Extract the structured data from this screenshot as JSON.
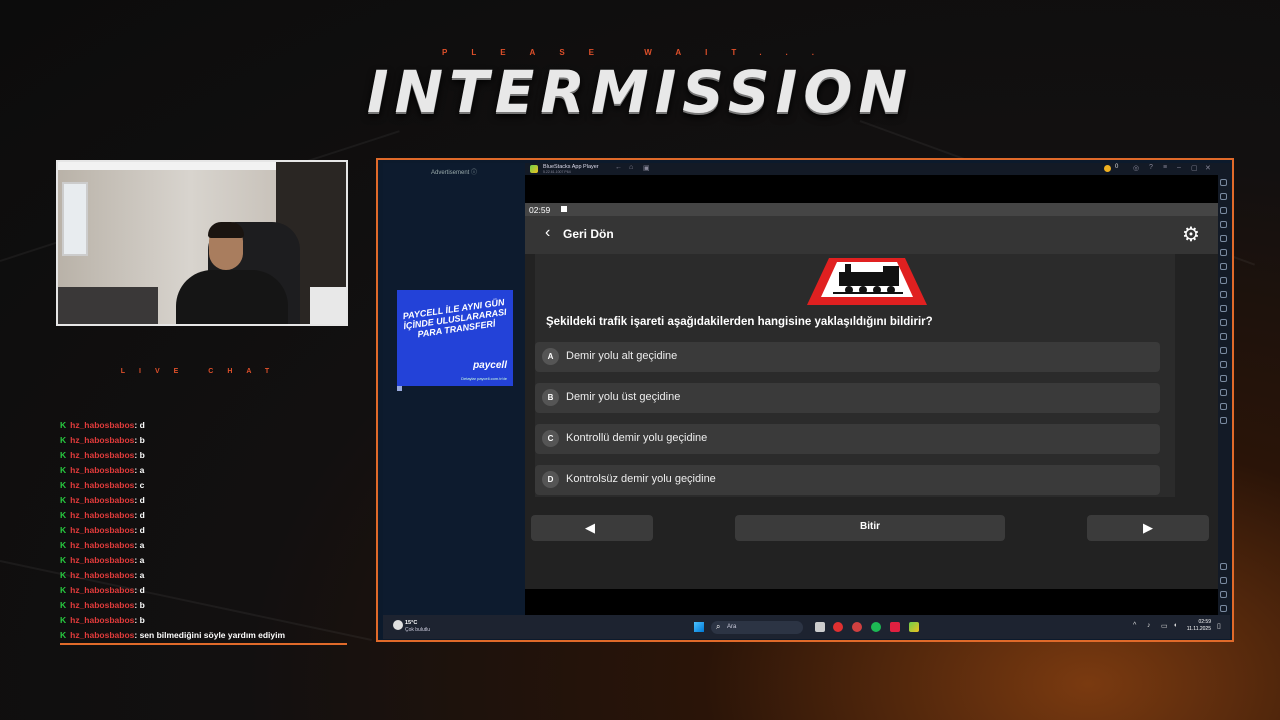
{
  "header": {
    "subtitle": "PLEASE WAIT...",
    "title": "INTERMISSION"
  },
  "live_chat": {
    "label": "LIVE CHAT",
    "messages": [
      {
        "badge": "K",
        "user": "hz_habosbabos",
        "text": ": d"
      },
      {
        "badge": "K",
        "user": "hz_habosbabos",
        "text": ": b"
      },
      {
        "badge": "K",
        "user": "hz_habosbabos",
        "text": ": b"
      },
      {
        "badge": "K",
        "user": "hz_habosbabos",
        "text": ": a"
      },
      {
        "badge": "K",
        "user": "hz_habosbabos",
        "text": ": c"
      },
      {
        "badge": "K",
        "user": "hz_habosbabos",
        "text": ": d"
      },
      {
        "badge": "K",
        "user": "hz_habosbabos",
        "text": ": d"
      },
      {
        "badge": "K",
        "user": "hz_habosbabos",
        "text": ": d"
      },
      {
        "badge": "K",
        "user": "hz_habosbabos",
        "text": ": a"
      },
      {
        "badge": "K",
        "user": "hz_habosbabos",
        "text": ": a"
      },
      {
        "badge": "K",
        "user": "hz_habosbabos",
        "text": ": a"
      },
      {
        "badge": "K",
        "user": "hz_habosbabos",
        "text": ": d"
      },
      {
        "badge": "K",
        "user": "hz_habosbabos",
        "text": ": b"
      },
      {
        "badge": "K",
        "user": "hz_habosbabos",
        "text": ": b"
      },
      {
        "badge": "K",
        "user": "hz_habosbabos",
        "text": ": sen bilmediğini söyle yardım ediyim"
      }
    ]
  },
  "ad": {
    "label": "Advertisement ⓘ",
    "headline": "PAYCELL İLE AYNI GÜN İÇİNDE ULUSLARARASI PARA TRANSFERİ",
    "brand": "paycell",
    "subtext": "Detaylar paycell.com.tr'de"
  },
  "bluestacks": {
    "title": "BlueStacks App Player",
    "subtitle": "5.22.61.1007 P64",
    "coins": "0",
    "status_time": "02:59",
    "back_label": "Geri Dön",
    "question": "Şekildeki trafik işareti aşağıdakilerden hangisine yaklaşıldığını bildirir?",
    "options": [
      {
        "letter": "A",
        "text": "Demir yolu alt geçidine"
      },
      {
        "letter": "B",
        "text": "Demir yolu üst geçidine"
      },
      {
        "letter": "C",
        "text": "Kontrollü demir yolu geçidine"
      },
      {
        "letter": "D",
        "text": "Kontrolsüz demir yolu geçidine"
      }
    ],
    "finish_label": "Bitir",
    "prev_icon": "◀",
    "next_icon": "▶"
  },
  "taskbar": {
    "weather_temp": "15°C",
    "weather_desc": "Çok bulutlu",
    "search_placeholder": "Ara",
    "clock_time": "02:59",
    "clock_date": "11.11.2025"
  },
  "colors": {
    "accent": "#e06a2a",
    "chat_user": "#e23b3b",
    "chat_badge": "#27c93f",
    "sign_red": "#e02020"
  }
}
